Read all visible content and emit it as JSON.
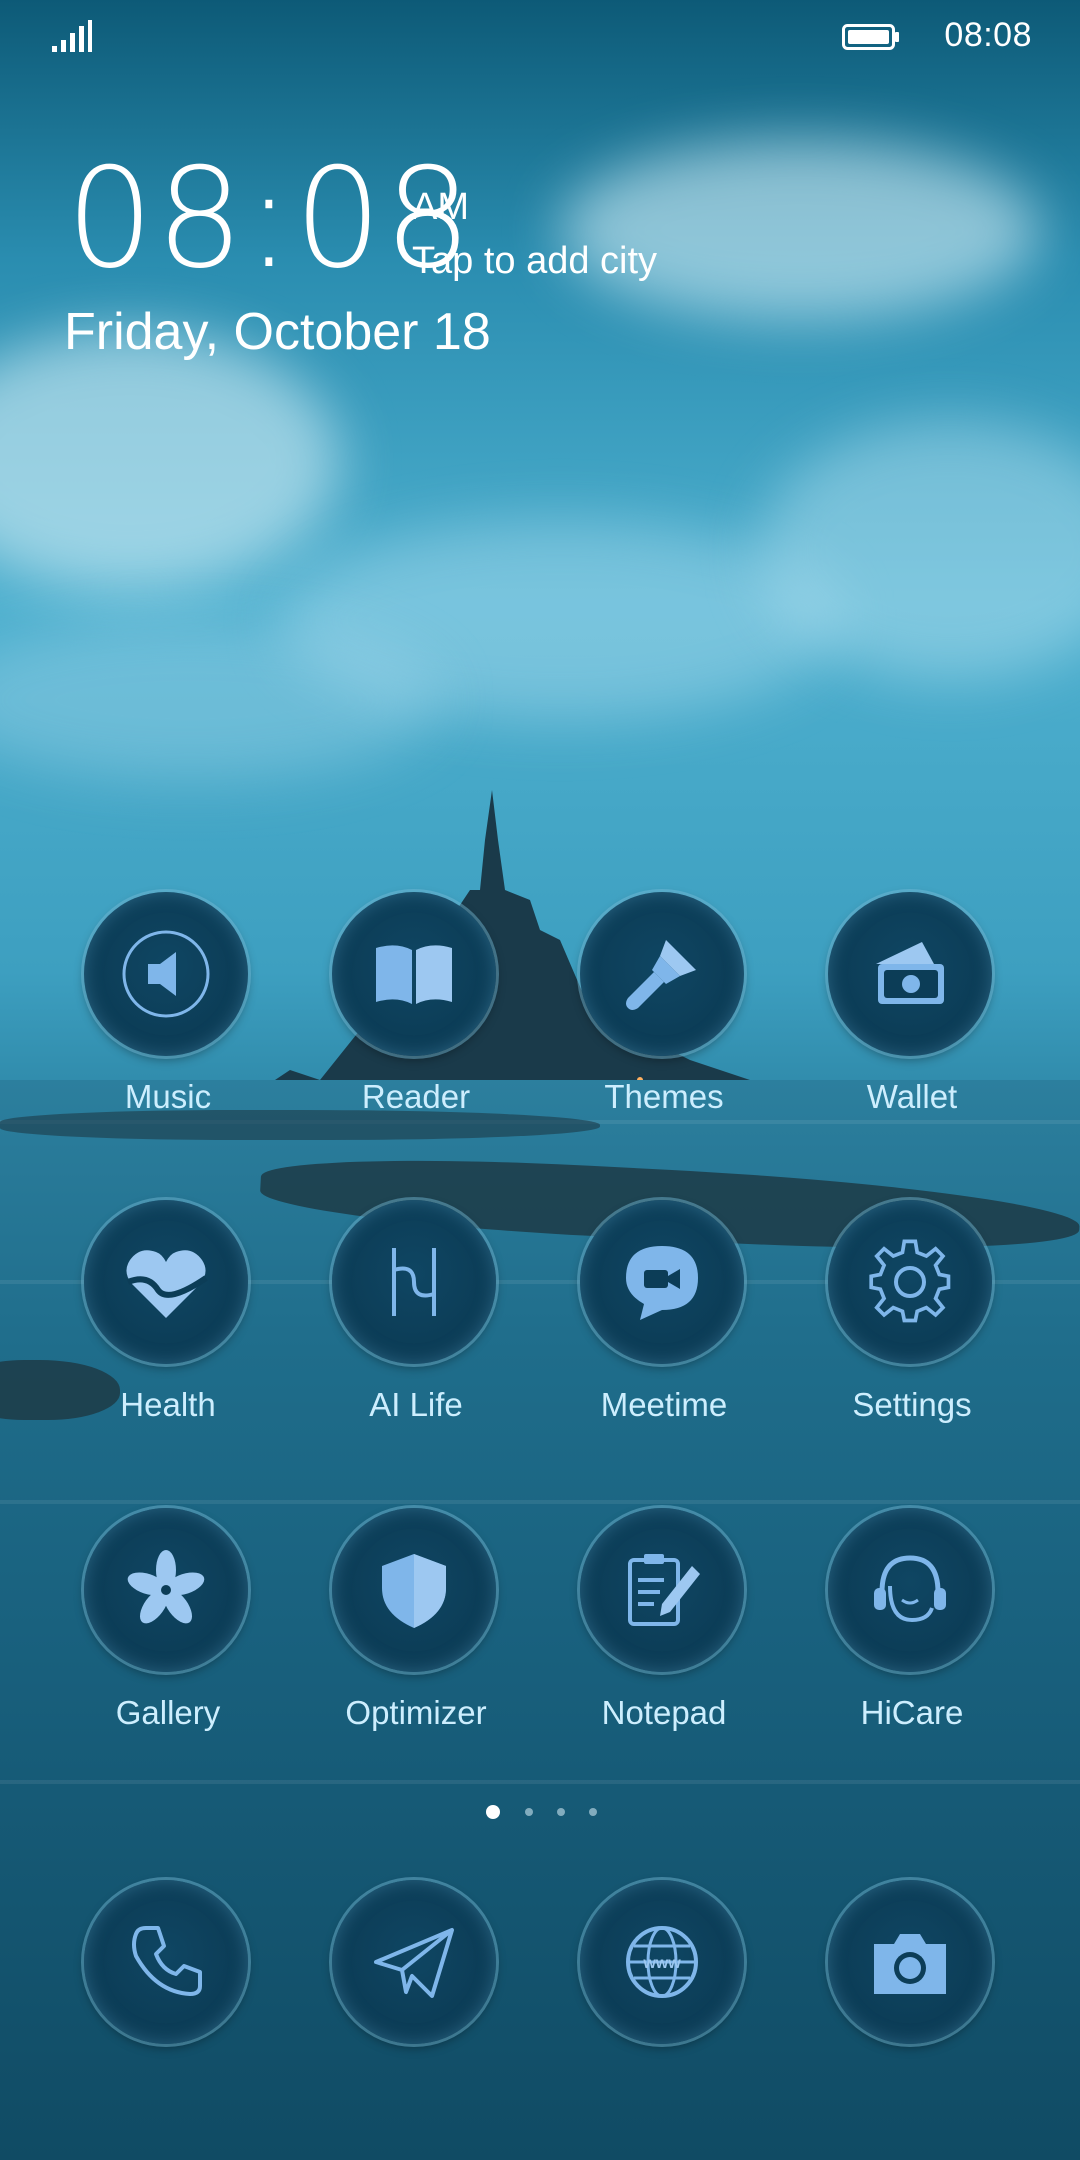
{
  "status_bar": {
    "time": "08:08",
    "signal_icon": "signal-icon",
    "battery_icon": "battery-icon"
  },
  "clock_widget": {
    "time": "08:08",
    "ampm": "AM",
    "city_prompt": "Tap to add city",
    "date": "Friday, October 18"
  },
  "apps": [
    {
      "label": "Music",
      "icon": "speaker-icon"
    },
    {
      "label": "Reader",
      "icon": "book-icon"
    },
    {
      "label": "Themes",
      "icon": "paintbrush-icon"
    },
    {
      "label": "Wallet",
      "icon": "wallet-icon"
    },
    {
      "label": "Health",
      "icon": "heart-icon"
    },
    {
      "label": "AI Life",
      "icon": "ai-life-icon"
    },
    {
      "label": "Meetime",
      "icon": "video-chat-icon"
    },
    {
      "label": "Settings",
      "icon": "gear-icon"
    },
    {
      "label": "Gallery",
      "icon": "flower-icon"
    },
    {
      "label": "Optimizer",
      "icon": "shield-icon"
    },
    {
      "label": "Notepad",
      "icon": "notepad-icon"
    },
    {
      "label": "HiCare",
      "icon": "headset-icon"
    }
  ],
  "page_indicator": {
    "pages": 4,
    "current": 1
  },
  "dock": [
    {
      "icon": "phone-icon"
    },
    {
      "icon": "send-icon"
    },
    {
      "icon": "browser-icon"
    },
    {
      "icon": "camera-icon"
    }
  ],
  "colors": {
    "icon_fill": "#7fb6ea",
    "label": "#cdeefe"
  }
}
